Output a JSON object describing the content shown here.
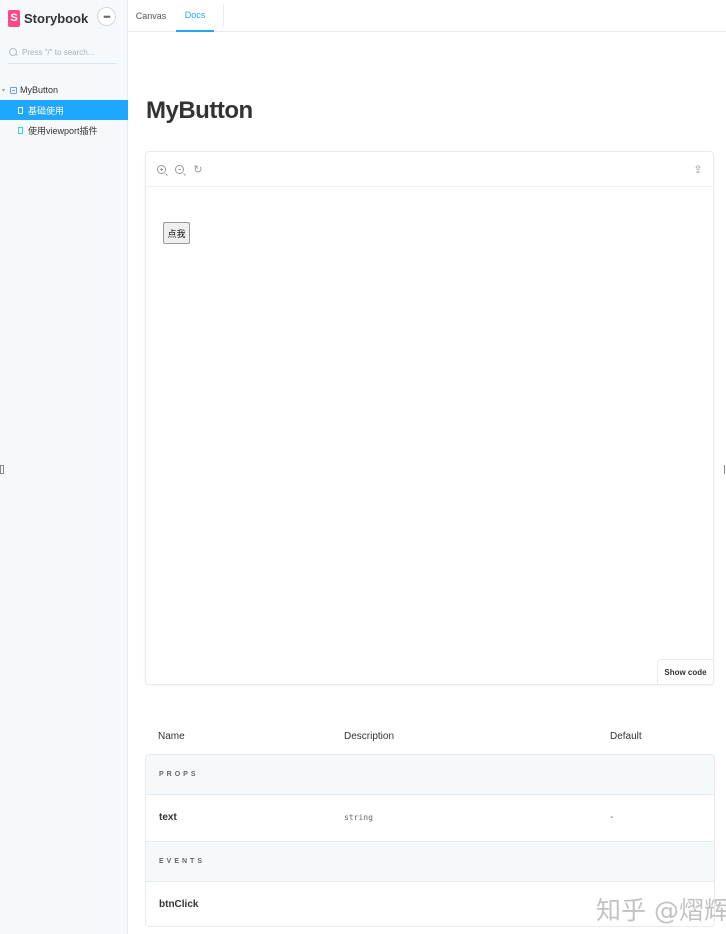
{
  "sidebar": {
    "brand": {
      "logo_letter": "S",
      "name": "Storybook"
    },
    "menu_button_label": "•••",
    "search": {
      "placeholder": "Press \"/\" to search..."
    },
    "tree": {
      "component": {
        "label": "MyButton"
      },
      "stories": [
        {
          "label": "基础使用",
          "active": true
        },
        {
          "label": "使用viewport插件",
          "active": false
        }
      ]
    }
  },
  "tabs": [
    {
      "label": "Canvas",
      "active": false
    },
    {
      "label": "Docs",
      "active": true
    }
  ],
  "docs": {
    "title": "MyButton",
    "preview": {
      "toolbar_icons": [
        "zoom-in-icon",
        "zoom-out-icon",
        "reset-zoom-icon",
        "share-icon"
      ],
      "demo_button_label": "点我",
      "show_code_label": "Show code"
    },
    "args_table": {
      "headers": {
        "name": "Name",
        "description": "Description",
        "default": "Default"
      },
      "sections": [
        {
          "label": "PROPS",
          "rows": [
            {
              "name": "text",
              "description": "string",
              "default": "-"
            }
          ]
        },
        {
          "label": "EVENTS",
          "rows": [
            {
              "name": "btnClick",
              "description": "",
              "default": ""
            }
          ]
        }
      ]
    }
  },
  "watermark": "知乎 @熠辉",
  "colors": {
    "accent": "#1ea7fd",
    "brand": "#ff4785",
    "sidebar_bg": "#f6f9fc",
    "border": "#e6ebf0"
  }
}
